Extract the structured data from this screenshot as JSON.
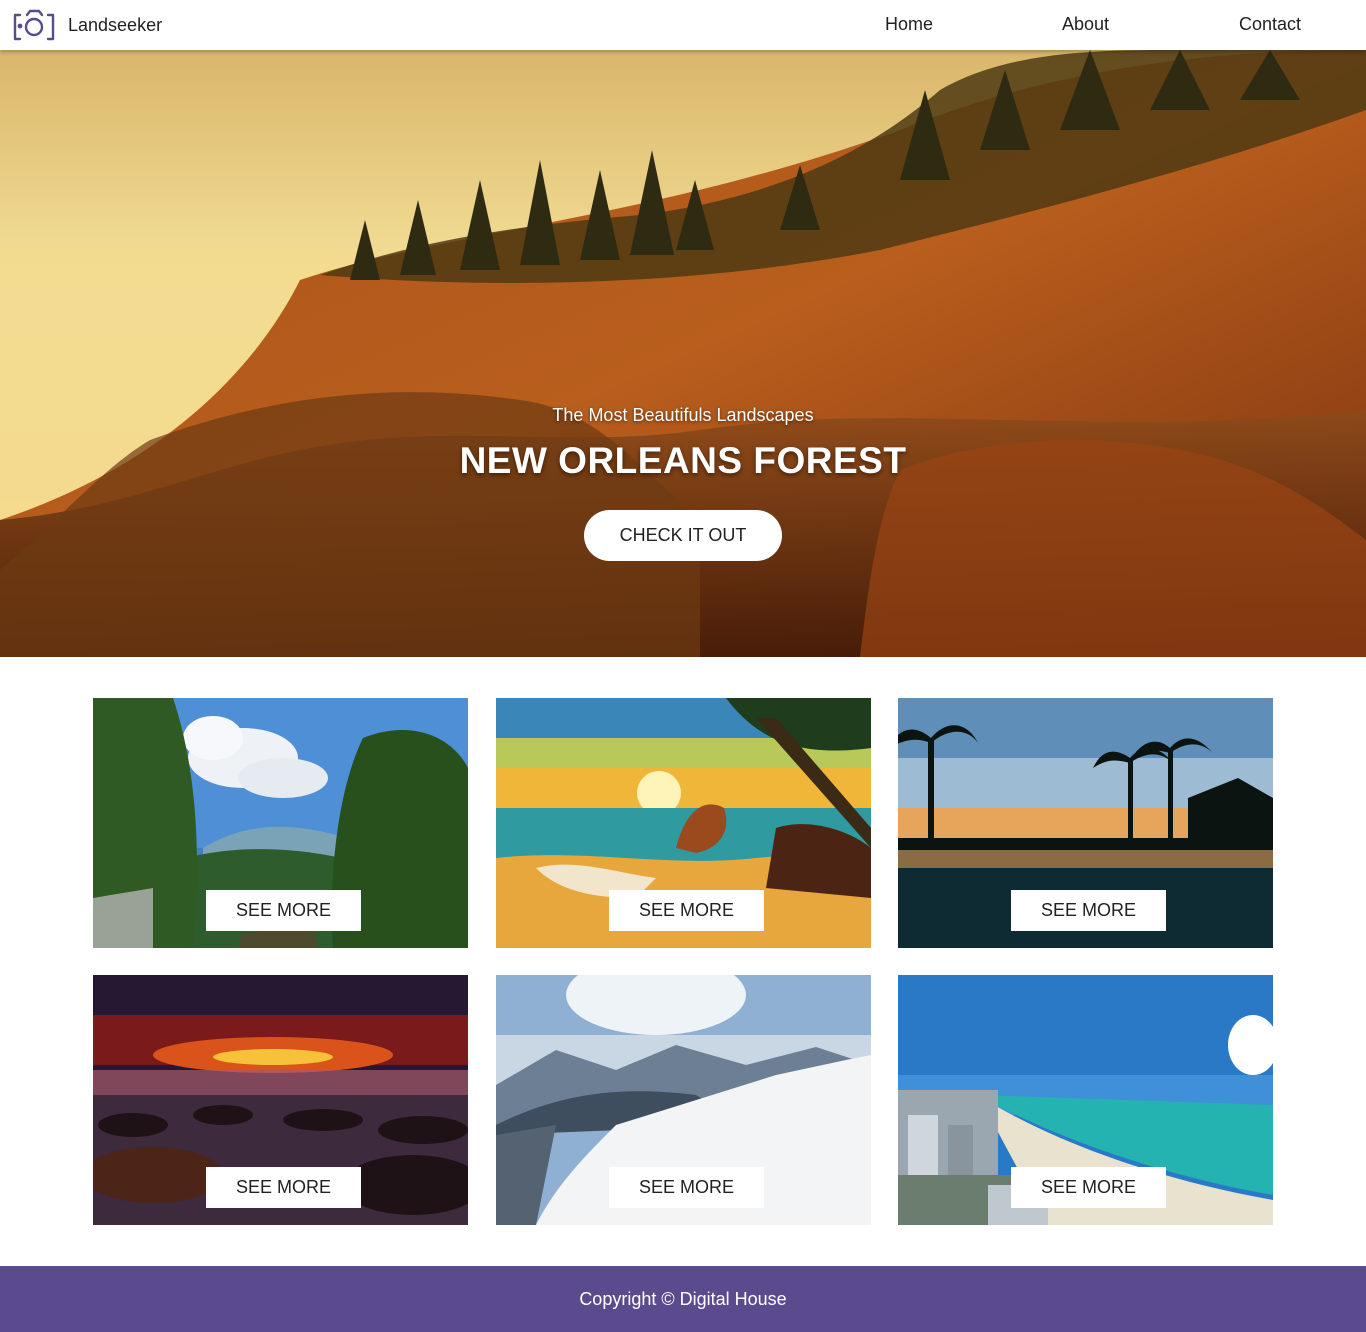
{
  "header": {
    "brand_name": "Landseeker",
    "logo_icon": "camera-icon",
    "nav": [
      {
        "label": "Home"
      },
      {
        "label": "About"
      },
      {
        "label": "Contact"
      }
    ]
  },
  "hero": {
    "subtitle": "The Most Beautifuls Landscapes",
    "title": "NEW ORLEANS FOREST",
    "button_label": "CHECK IT OUT",
    "image": "sunset-rocky-coast-photo"
  },
  "gallery": {
    "cards": [
      {
        "image": "forest-valley-photo",
        "button_label": "SEE MORE"
      },
      {
        "image": "tropical-beach-sunset-photo",
        "button_label": "SEE MORE"
      },
      {
        "image": "palm-pool-sunset-photo",
        "button_label": "SEE MORE"
      },
      {
        "image": "rocky-shore-red-sky-photo",
        "button_label": "SEE MORE"
      },
      {
        "image": "snowy-mountains-photo",
        "button_label": "SEE MORE"
      },
      {
        "image": "miami-beach-aerial-photo",
        "button_label": "SEE MORE"
      }
    ]
  },
  "footer": {
    "copyright": "Copyright © Digital House"
  },
  "colors": {
    "brand_purple": "#5c4a8f",
    "header_bg": "#ffffff",
    "button_bg": "#ffffff"
  }
}
